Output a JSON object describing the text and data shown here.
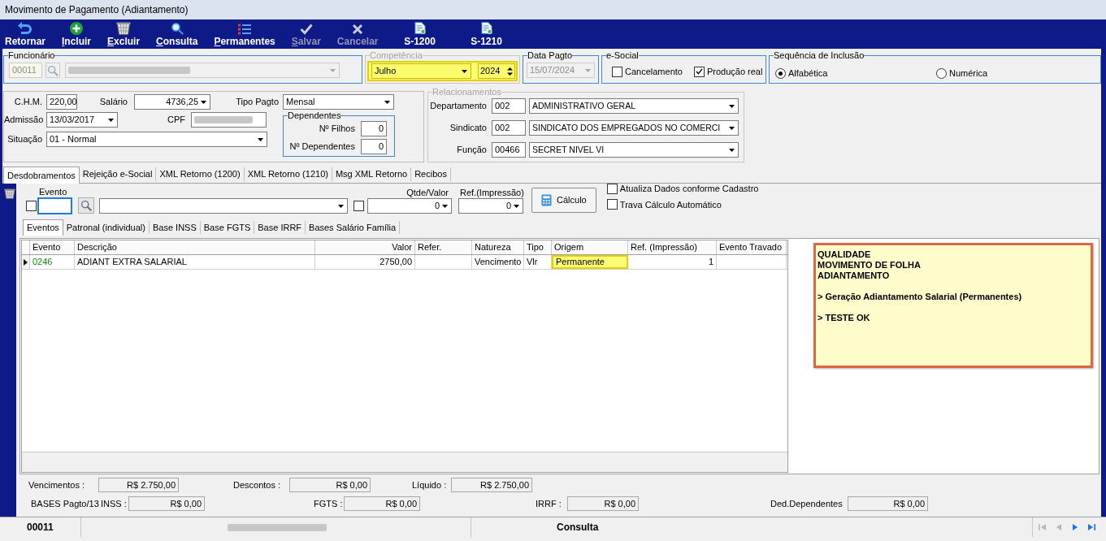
{
  "window": {
    "title": "Movimento de Pagamento (Adiantamento)"
  },
  "toolbar": [
    {
      "label": "Retornar",
      "kind": "return",
      "mnemonic": false,
      "disabled": false
    },
    {
      "label": "Incluir",
      "kind": "add",
      "mnemonic": true,
      "disabled": false
    },
    {
      "label": "Excluir",
      "kind": "delete",
      "mnemonic": true,
      "disabled": false
    },
    {
      "label": "Consulta",
      "kind": "search",
      "mnemonic": true,
      "disabled": false
    },
    {
      "label": "Permanentes",
      "kind": "list",
      "mnemonic": true,
      "disabled": false
    },
    {
      "label": "Salvar",
      "kind": "save",
      "mnemonic": true,
      "disabled": true
    },
    {
      "label": "Cancelar",
      "kind": "cancel",
      "mnemonic": false,
      "disabled": true
    },
    {
      "label": "S-1200",
      "kind": "esocial",
      "mnemonic": false,
      "disabled": false
    },
    {
      "label": "S-1210",
      "kind": "esocial",
      "mnemonic": false,
      "disabled": false
    }
  ],
  "employee": {
    "legend": "Funcionário",
    "code": "00011",
    "disabled": true
  },
  "competencia": {
    "legend": "Competência",
    "disabled": true,
    "highlighted": true,
    "month": "Julho",
    "year": "2024"
  },
  "data_pagto": {
    "legend": "Data Pagto",
    "value": "15/07/2024",
    "disabled": true
  },
  "esocial": {
    "legend": "e-Social",
    "options": [
      {
        "label": "Cancelamento",
        "checked": false
      },
      {
        "label": "Produção real",
        "checked": true
      }
    ]
  },
  "sequencia": {
    "legend": "Sequência de Inclusão",
    "options": [
      {
        "label": "Alfabética",
        "selected": true
      },
      {
        "label": "Numérica",
        "selected": false
      }
    ]
  },
  "details": {
    "chm": {
      "label": "C.H.M.",
      "value": "220,00"
    },
    "salario": {
      "label": "Salário",
      "value": "4736,25"
    },
    "tipo_pagto": {
      "label": "Tipo Pagto",
      "value": "Mensal"
    },
    "admissao": {
      "label": "Admissão",
      "value": "13/03/2017"
    },
    "cpf": {
      "label": "CPF"
    },
    "situacao": {
      "label": "Situação",
      "value": "01 - Normal"
    }
  },
  "dependentes": {
    "legend": "Dependentes",
    "fields": [
      {
        "label": "Nº Filhos",
        "value": "0"
      },
      {
        "label": "Nº Dependentes",
        "value": "0"
      }
    ]
  },
  "relacionamentos": {
    "legend": "Relacionamentos",
    "disabled": true,
    "rows": [
      {
        "label": "Departamento",
        "code": "002",
        "name": "ADMINISTRATIVO GERAL"
      },
      {
        "label": "Sindicato",
        "code": "002",
        "name": "SINDICATO DOS EMPREGADOS NO COMERCI"
      },
      {
        "label": "Função",
        "code": "00466",
        "name": "SECRET NIVEL VI"
      }
    ]
  },
  "tabs": [
    {
      "label": "Desdobramentos",
      "selected": true
    },
    {
      "label": "Rejeição e-Social",
      "selected": false
    },
    {
      "label": "XML Retorno (1200)",
      "selected": false
    },
    {
      "label": "XML Retorno (1210)",
      "selected": false
    },
    {
      "label": "Msg XML Retorno",
      "selected": false
    },
    {
      "label": "Recibos",
      "selected": false
    }
  ],
  "event_entry": {
    "evento": {
      "label": "Evento",
      "checked": false,
      "focused": true
    },
    "qtde": {
      "label": "Qtde/Valor",
      "value": "0",
      "checked": false
    },
    "ref": {
      "label": "Ref.(Impressão)",
      "value": "0"
    },
    "calc_button": "Cálculo",
    "options": [
      {
        "label": "Atualiza Dados conforme Cadastro",
        "checked": false
      },
      {
        "label": "Trava Cálculo Automático",
        "checked": false
      }
    ]
  },
  "subtabs": [
    {
      "label": "Eventos",
      "selected": true
    },
    {
      "label": "Patronal (individual)",
      "selected": false
    },
    {
      "label": "Base INSS",
      "selected": false
    },
    {
      "label": "Base FGTS",
      "selected": false
    },
    {
      "label": "Base IRRF",
      "selected": false
    },
    {
      "label": "Bases Salário Família",
      "selected": false
    }
  ],
  "grid": {
    "columns": [
      {
        "label": "Evento",
        "kind": "code"
      },
      {
        "label": "Descrição",
        "kind": "text"
      },
      {
        "label": "Valor",
        "kind": "money"
      },
      {
        "label": "Refer.",
        "kind": "number"
      },
      {
        "label": "Natureza",
        "kind": "text"
      },
      {
        "label": "Tipo",
        "kind": "text"
      },
      {
        "label": "Origem",
        "kind": "text"
      },
      {
        "label": "Ref. (Impressão)",
        "kind": "number"
      },
      {
        "label": "Evento Travado",
        "kind": "text"
      }
    ],
    "rows": [
      {
        "current": true,
        "cells": [
          {
            "text": "0246",
            "highlighted": false
          },
          {
            "text": "ADIANT EXTRA SALARIAL",
            "highlighted": false
          },
          {
            "text": "2750,00",
            "highlighted": false
          },
          {
            "highlighted": false
          },
          {
            "text": "Vencimento",
            "highlighted": false
          },
          {
            "text": "Vlr",
            "highlighted": false
          },
          {
            "text": "Permanente",
            "highlighted": true
          },
          {
            "text": "1",
            "highlighted": false
          },
          {
            "highlighted": false
          }
        ]
      }
    ]
  },
  "note": {
    "paragraphs": [
      [
        "QUALIDADE",
        "MOVIMENTO DE FOLHA",
        "ADIANTAMENTO"
      ],
      [
        "> Geração Adiantamento Salarial (Permanentes)"
      ],
      [
        "> TESTE OK"
      ]
    ]
  },
  "totals": [
    {
      "label": "Vencimentos :",
      "value": "R$ 2.750,00"
    },
    {
      "label": "Descontos :",
      "value": "R$ 0,00"
    },
    {
      "label": "Líquido :",
      "value": "R$ 2.750,00"
    }
  ],
  "bases": {
    "label": "BASES Pagto/13",
    "items": [
      {
        "label": "INSS :",
        "value": "R$ 0,00"
      },
      {
        "label": "FGTS :",
        "value": "R$ 0,00"
      },
      {
        "label": "IRRF :",
        "value": "R$ 0,00"
      },
      {
        "label": "Ded.Dependentes",
        "value": "R$ 0,00"
      }
    ]
  },
  "status_bar": {
    "code": "00011",
    "mode": "Consulta",
    "nav": [
      {
        "kind": "first",
        "disabled": true
      },
      {
        "kind": "prev",
        "disabled": true
      },
      {
        "kind": "next",
        "disabled": false
      },
      {
        "kind": "last",
        "disabled": false
      }
    ]
  }
}
